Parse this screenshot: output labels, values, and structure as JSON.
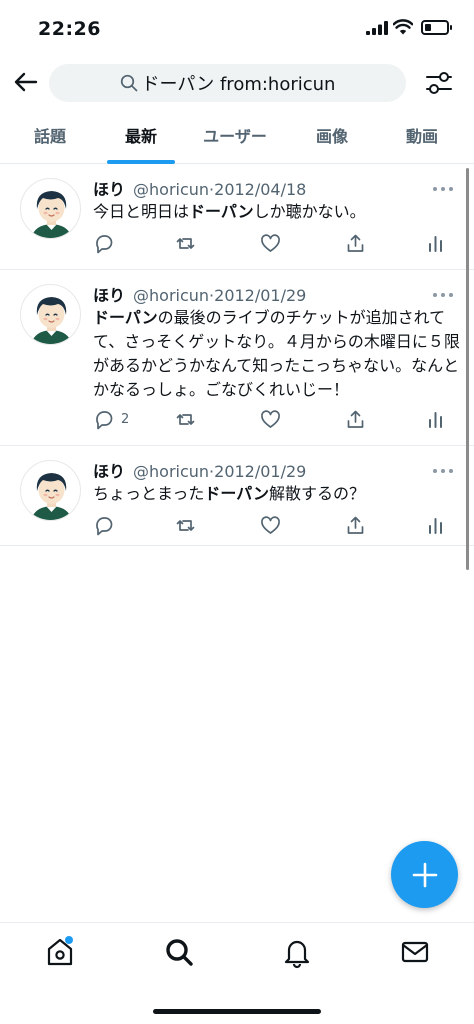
{
  "status_bar": {
    "time": "22:26",
    "battery_level": 0.3
  },
  "search": {
    "query": "ドーパン from:horicun"
  },
  "tabs": [
    {
      "label": "話題"
    },
    {
      "label": "最新"
    },
    {
      "label": "ユーザー"
    },
    {
      "label": "画像"
    },
    {
      "label": "動画"
    }
  ],
  "active_tab": "最新",
  "tweets": [
    {
      "name": "ほり",
      "handle": "@horicun",
      "separator": "·",
      "date": "2012/04/18",
      "text_before": "今日と明日は",
      "highlight": "ドーパン",
      "text_after": "しか聴かない。",
      "reply_count": ""
    },
    {
      "name": "ほり",
      "handle": "@horicun",
      "separator": "·",
      "date": "2012/01/29",
      "text_before": "",
      "highlight": "ドーパン",
      "text_after": "の最後のライブのチケットが追加されてて、さっそくゲットなり。４月からの木曜日に５限があるかどうかなんて知ったこっちゃない。なんとかなるっしょ。ごなびくれいじー！",
      "reply_count": "2"
    },
    {
      "name": "ほり",
      "handle": "@horicun",
      "separator": "·",
      "date": "2012/01/29",
      "text_before": "ちょっとまった",
      "highlight": "ドーパン",
      "text_after": "解散するの？",
      "reply_count": ""
    }
  ],
  "icons": {
    "back": "arrow-left-icon",
    "search": "search-icon",
    "filter": "sliders-icon",
    "reply": "reply-icon",
    "retweet": "retweet-icon",
    "like": "heart-icon",
    "share": "share-icon",
    "analytics": "analytics-icon",
    "compose": "plus-icon",
    "home": "home-icon",
    "explore": "search-icon",
    "notifications": "bell-icon",
    "messages": "mail-icon"
  },
  "colors": {
    "accent": "#1d9bf0",
    "text": "#0f1419",
    "muted": "#536471"
  }
}
